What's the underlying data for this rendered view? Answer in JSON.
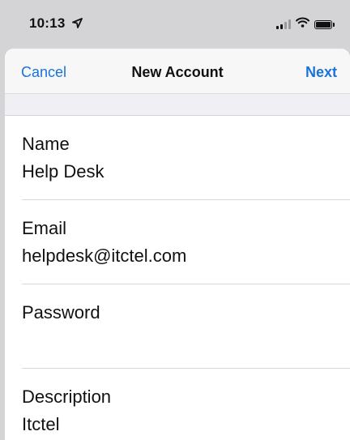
{
  "status_bar": {
    "time": "10:13",
    "icons": [
      "location-arrow-icon",
      "cellular-signal-icon",
      "wifi-icon",
      "battery-icon"
    ]
  },
  "nav": {
    "cancel_label": "Cancel",
    "title": "New Account",
    "next_label": "Next"
  },
  "form": {
    "fields": [
      {
        "label": "Name",
        "value": "Help Desk"
      },
      {
        "label": "Email",
        "value": "helpdesk@itctel.com"
      },
      {
        "label": "Password",
        "value": ""
      },
      {
        "label": "Description",
        "value": "Itctel"
      }
    ]
  },
  "colors": {
    "accent": "#1a73d9",
    "background": "#d4d4d6",
    "sheet": "#ffffff"
  }
}
